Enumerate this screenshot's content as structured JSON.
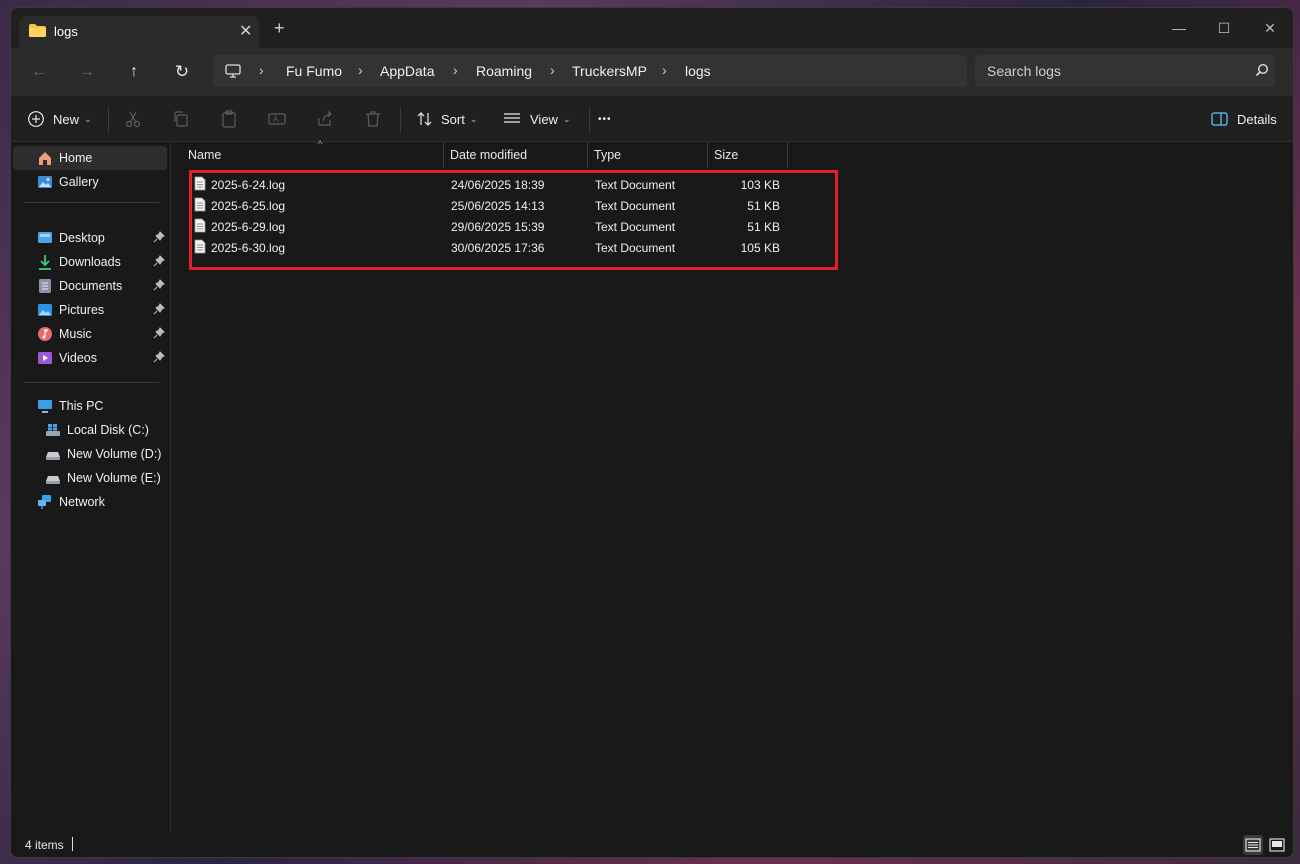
{
  "tab": {
    "title": "logs",
    "close_glyph": "✕",
    "new_tab_glyph": "+"
  },
  "window_controls": {
    "minimize": "—",
    "maximize": "☐",
    "close": "✕"
  },
  "nav": {
    "back_glyph": "←",
    "forward_glyph": "→",
    "up_glyph": "↑",
    "refresh_glyph": "↻"
  },
  "breadcrumb": {
    "items": [
      "Fu Fumo",
      "AppData",
      "Roaming",
      "TruckersMP",
      "logs"
    ],
    "separator": "›"
  },
  "search": {
    "placeholder": "Search logs"
  },
  "commands": {
    "new_label": "New",
    "sort_label": "Sort",
    "view_label": "View",
    "more_glyph": "•••",
    "details_label": "Details",
    "chevron": "⌄"
  },
  "sidebar": {
    "home": "Home",
    "gallery": "Gallery",
    "quick": [
      "Desktop",
      "Downloads",
      "Documents",
      "Pictures",
      "Music",
      "Videos"
    ],
    "this_pc": "This PC",
    "drives": [
      "Local Disk (C:)",
      "New Volume (D:)",
      "New Volume (E:)"
    ],
    "network": "Network"
  },
  "columns": {
    "name": "Name",
    "date": "Date modified",
    "type": "Type",
    "size": "Size"
  },
  "sort_caret": "^",
  "files": [
    {
      "name": "2025-6-24.log",
      "date": "24/06/2025 18:39",
      "type": "Text Document",
      "size": "103 KB"
    },
    {
      "name": "2025-6-25.log",
      "date": "25/06/2025 14:13",
      "type": "Text Document",
      "size": "51 KB"
    },
    {
      "name": "2025-6-29.log",
      "date": "29/06/2025 15:39",
      "type": "Text Document",
      "size": "51 KB"
    },
    {
      "name": "2025-6-30.log",
      "date": "30/06/2025 17:36",
      "type": "Text Document",
      "size": "105 KB"
    }
  ],
  "status": {
    "count": "4 items"
  },
  "colors": {
    "accent": "#60cdff",
    "highlight": "#e0202a",
    "folder": "#f5c542"
  }
}
